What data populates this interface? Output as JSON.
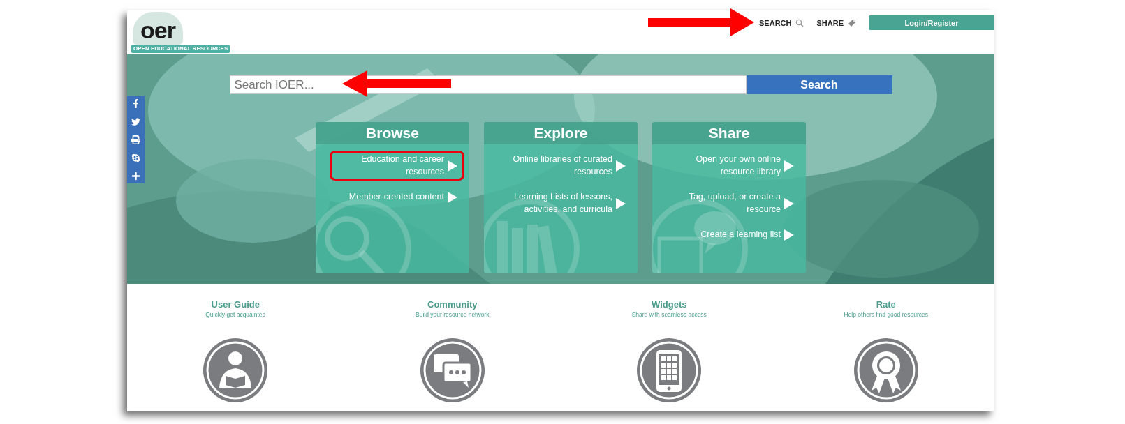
{
  "logo": {
    "text": "oer",
    "tagline": "OPEN EDUCATIONAL RESOURCES"
  },
  "header_nav": [
    {
      "label": "SEARCH",
      "kind": "search"
    },
    {
      "label": "SHARE",
      "kind": "tag"
    }
  ],
  "login_button": "Login/Register",
  "search": {
    "placeholder": "Search IOER...",
    "button": "Search"
  },
  "social_links": [
    {
      "kind": "facebook"
    },
    {
      "kind": "twitter"
    },
    {
      "kind": "print"
    },
    {
      "kind": "skype"
    },
    {
      "kind": "more"
    }
  ],
  "tiles": [
    {
      "title": "Browse",
      "kind": "magnifier",
      "links": [
        {
          "label": "Education and career resources",
          "highlighted": true
        },
        {
          "label": "Member-created content",
          "highlighted": false
        }
      ]
    },
    {
      "title": "Explore",
      "kind": "books",
      "links": [
        {
          "label": "Online libraries of curated resources",
          "highlighted": false
        },
        {
          "label": "Learning Lists of lessons, activities, and curricula",
          "highlighted": false
        }
      ]
    },
    {
      "title": "Share",
      "kind": "chat",
      "links": [
        {
          "label": "Open your own online resource library",
          "highlighted": false
        },
        {
          "label": "Tag, upload, or create a resource",
          "highlighted": false
        },
        {
          "label": "Create a learning list",
          "highlighted": false
        }
      ]
    }
  ],
  "features": [
    {
      "title": "User Guide",
      "subtitle": "Quickly get acquainted",
      "kind": "reader"
    },
    {
      "title": "Community",
      "subtitle": "Build your resource network",
      "kind": "chat"
    },
    {
      "title": "Widgets",
      "subtitle": "Share with seamless access",
      "kind": "tablet"
    },
    {
      "title": "Rate",
      "subtitle": "Help others find good resources",
      "kind": "award"
    }
  ]
}
